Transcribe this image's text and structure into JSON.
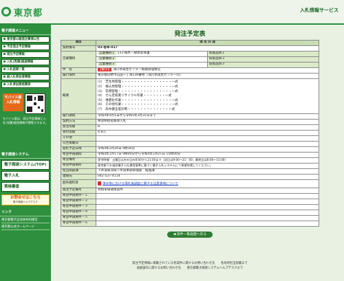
{
  "header": {
    "org": "東京都",
    "service": "入札情報サービス"
  },
  "sidebar": {
    "section1": "電子調達メニュー",
    "items": [
      "東京都公報発注事項公告",
      "予定発注予定情報",
      "発注予定情報",
      "入札(見積)経過情報",
      "入札結果一覧",
      "統入札参加者情報",
      "入札参加資格関係"
    ],
    "mobile_badge": "モバイル版",
    "mobile_sub": "入札情報",
    "mobile_text": "モバイル版は、発注予定情報と入札(見積)経過情報が閲覧できます。",
    "section2": "電子調達システム",
    "big_items": [
      "電子調達システム(TOP)",
      "電子入札",
      "資格審査"
    ],
    "ask_title": "お問合せはこちら",
    "ask_sub": "電子調達ヘルプデスク",
    "section3": "リンク",
    "links": [
      "東京都電子自治体共同運営",
      "東京都公式ホームページ"
    ]
  },
  "page": {
    "title": "発注予定表"
  },
  "table": {
    "head_item": "項目",
    "head_content": "項 目 内 容",
    "contract_no_label": "契約番号",
    "contract_no": "03-巻草-017",
    "business_label": "営業種目",
    "business_rows": [
      {
        "name": "営業種目１",
        "value": "133 樹木・緑地等保護",
        "extra": "取扱品目１"
      },
      {
        "name": "営業種目２",
        "value": "",
        "extra": "取扱品目２"
      },
      {
        "name": "営業種目３",
        "value": "",
        "extra": "取扱品目３"
      }
    ],
    "subject_label": "件　名",
    "subject_tag": "【電子】",
    "subject": "浅川水再生センター植栽管理委託",
    "location_label": "履行場所",
    "location": "東京都日野市石田一丁目236番地（浅川水再生センター内）",
    "overview_label": "概要",
    "overview": [
      "(1)　芝生地管理・・・・・・・・・・・・・・・・一式",
      "(2)　植込地管理・・・・・・・・・・・・・・・・一式",
      "(3)　花壇管理・・・・・・・・・・・・・・・・・一式",
      "(4)　せん定枝葉リサイクル作業・・・・・・・一式",
      "(5)　堆肥化作業・・・・・・・・・・・・・・・・一式",
      "(6)　その他作業・・・・・・・・・・・・・・・・一式",
      "(7)　高木健全度診断・・・・・・・・・・・・・一式"
    ],
    "period_label": "履行期間",
    "period": "令和4年4月1日から令和5年3月31日まで",
    "method_label": "契約方法",
    "method": "希望制指名競争入札",
    "grade_label": "発注等級",
    "grade": "B",
    "accept_label": "受付等級",
    "accept": "A,B,C",
    "other_label": "その他",
    "other": "",
    "public_label": "公告掲載日",
    "public": "",
    "schedule_label": "開札予定日時",
    "schedule": "令和4年2月26日 9時30分",
    "apply_period_label": "希望申請期間",
    "apply_period": "令和4年1月17日 9時00分から令和4年1月21日 15時00分",
    "apply_note_label": "希望備考",
    "apply_note": "受付時間　土曜日以外の日の8:00から21:00まで（初日は9:00～21：00、最終日は8:00～15:00）",
    "apply_method_label": "希望申請場所",
    "apply_method": "東京都下水道局電子入札運用基準に基づく電子入札システムにて希望申請してください。",
    "dept_label": "担当局部課",
    "dept": "下水道局流域下水道本部管理部　経理課",
    "contact_label": "連絡先",
    "contact": "042-527-4114",
    "docs_label": "配布資料等",
    "docs_link": "浄水等における落札後調査に関する注意事項について",
    "condition_label": "発注予定備考",
    "condition": "労務単価適用案件",
    "req_labels": [
      "希望申請要件－１",
      "希望申請要件－２",
      "希望申請要件－３",
      "希望申請要件－４",
      "希望申請要件－５",
      "希望申請要件－６"
    ]
  },
  "buttons": {
    "back": "◀ 案件一覧画面へ戻る"
  },
  "footer": {
    "line1": "発注予定情報に掲載されている各案件に関するお問い合わせ先　　各局所担当部署まで",
    "line2": "画面操作に関するお問い合わせ先　　東京都電子調達システムヘルプデスクまで"
  }
}
